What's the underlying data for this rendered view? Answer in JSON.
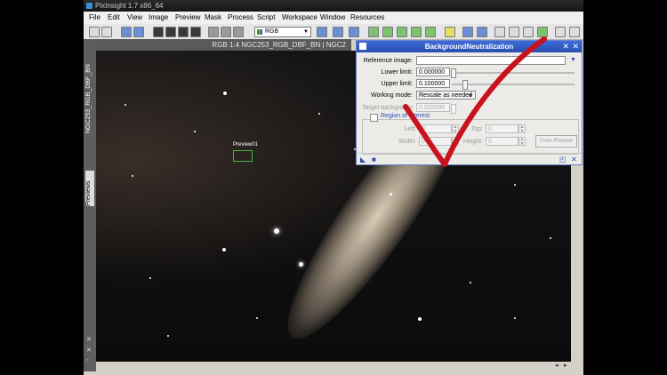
{
  "window": {
    "title": "PixInsight 1.7 x86_64"
  },
  "menu": [
    "File",
    "Edit",
    "View",
    "Image",
    "Preview",
    "Mask",
    "Process",
    "Script",
    "Workspace",
    "Window",
    "Resources"
  ],
  "toolbar": {
    "channel_select": "RGB"
  },
  "image_window": {
    "title": "RGB 1:4 NGC253_RGB_DBF_BN | NGC2",
    "side_tab": "NGC253_RGB_DBF_BN",
    "preview_tab": "Previews",
    "preview_label": "Preview01"
  },
  "dialog": {
    "title": "BackgroundNeutralization",
    "reference_image_label": "Reference image:",
    "reference_image_value": "",
    "lower_limit_label": "Lower limit:",
    "lower_limit_value": "0.000000",
    "upper_limit_label": "Upper limit:",
    "upper_limit_value": "0.100000",
    "working_mode_label": "Working mode:",
    "working_mode_value": "Rescale as needed",
    "target_background_label": "Target background:",
    "target_background_value": "0.010000",
    "roi_label": "Region of Interest",
    "left_label": "Left:",
    "left_value": "0",
    "top_label": "Top:",
    "top_value": "0",
    "width_label": "Width:",
    "width_value": "0",
    "height_label": "Height:",
    "height_value": "0",
    "from_preview_label": "From Preview"
  },
  "colors": {
    "accent": "#2a4fb0",
    "checkmark": "#c8121e",
    "preview_box": "#41b541"
  }
}
